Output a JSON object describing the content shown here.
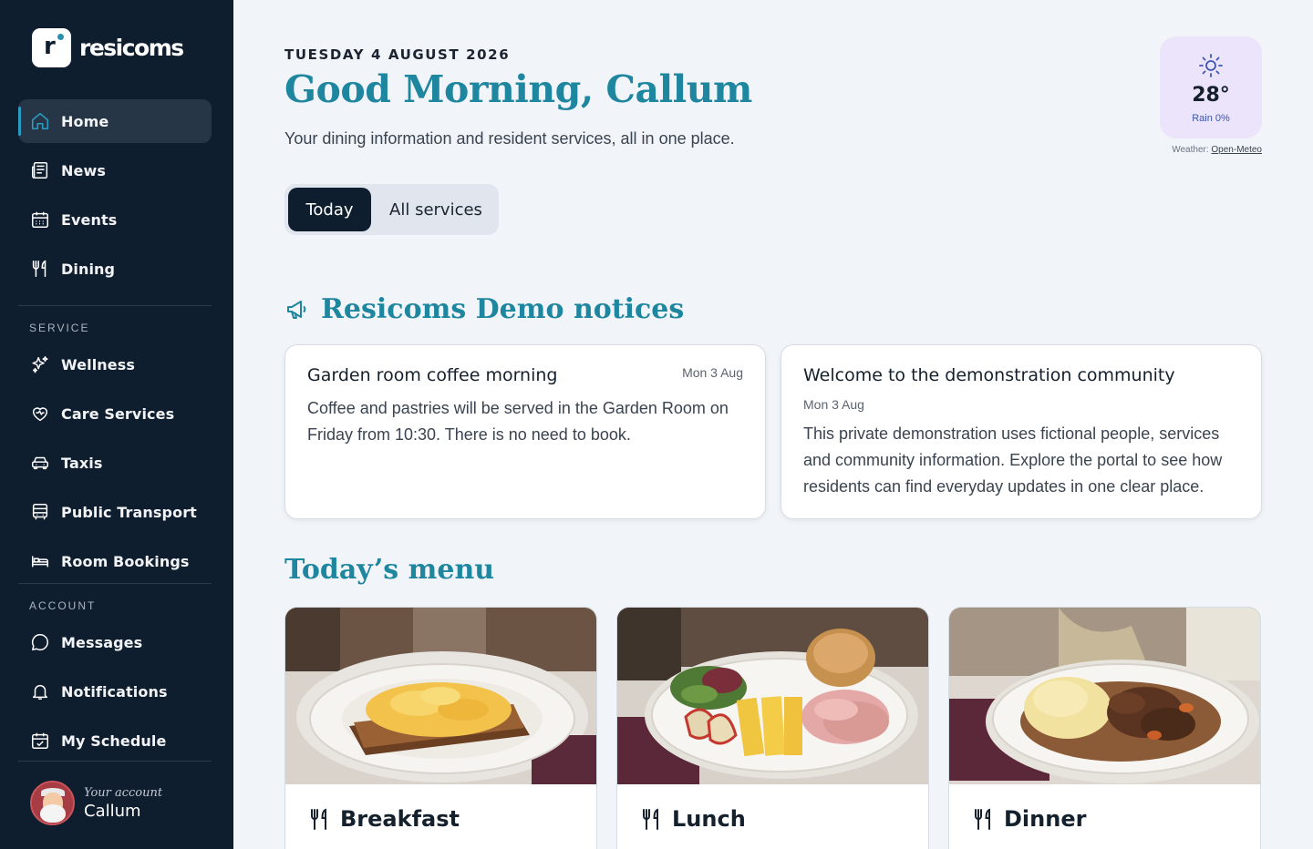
{
  "app": {
    "name": "resicoms",
    "logo_letter": "r"
  },
  "sidebar": {
    "primary": [
      {
        "label": "Home",
        "icon": "home-icon",
        "active": true
      },
      {
        "label": "News",
        "icon": "newspaper-icon"
      },
      {
        "label": "Events",
        "icon": "calendar-icon"
      },
      {
        "label": "Dining",
        "icon": "cutlery-icon"
      }
    ],
    "service_heading": "SERVICE",
    "service": [
      {
        "label": "Wellness",
        "icon": "sparkles-icon"
      },
      {
        "label": "Care Services",
        "icon": "heart-hand-icon"
      },
      {
        "label": "Taxis",
        "icon": "car-icon"
      },
      {
        "label": "Public Transport",
        "icon": "bus-icon"
      },
      {
        "label": "Room Bookings",
        "icon": "bed-icon"
      }
    ],
    "account_heading": "ACCOUNT",
    "account": [
      {
        "label": "Messages",
        "icon": "chat-bubble-icon"
      },
      {
        "label": "Notifications",
        "icon": "bell-icon"
      },
      {
        "label": "My Schedule",
        "icon": "calendar-check-icon"
      }
    ],
    "user": {
      "caption": "Your account",
      "name": "Callum"
    }
  },
  "header": {
    "date": "TUESDAY 4 AUGUST 2026",
    "greeting": "Good Morning, Callum",
    "subtitle": "Your dining information and resident services, all in one place."
  },
  "weather": {
    "icon": "sun-icon",
    "temperature": "28°",
    "rain": "Rain 0%",
    "credit_prefix": "Weather:",
    "credit_link": "Open-Meteo"
  },
  "view_toggle": {
    "options": [
      "Today",
      "All services"
    ],
    "selected": "Today"
  },
  "notices": {
    "icon": "megaphone-icon",
    "title": "Resicoms Demo notices",
    "items": [
      {
        "title": "Garden room coffee morning",
        "date": "Mon 3 Aug",
        "body": "Coffee and pastries will be served in the Garden Room on Friday from 10:30. There is no need to book."
      },
      {
        "title": "Welcome to the demonstration community",
        "date": "Mon 3 Aug",
        "body": "This private demonstration uses fictional people, services and community information. Explore the portal to see how residents can find everyday updates in one clear place."
      }
    ]
  },
  "menu": {
    "title": "Today’s menu",
    "meals": [
      {
        "name": "Breakfast",
        "icon": "cutlery-icon",
        "image": "scrambled-eggs-on-toast"
      },
      {
        "name": "Lunch",
        "icon": "cutlery-icon",
        "image": "ham-cheese-salad-plate"
      },
      {
        "name": "Dinner",
        "icon": "cutlery-icon",
        "image": "beef-stew-with-mash"
      }
    ]
  },
  "colors": {
    "sidebar_bg": "#0f1e2e",
    "accent": "#1f86a0",
    "active_indicator": "#2a9bc2",
    "weather_bg": "#ebe4fa"
  }
}
